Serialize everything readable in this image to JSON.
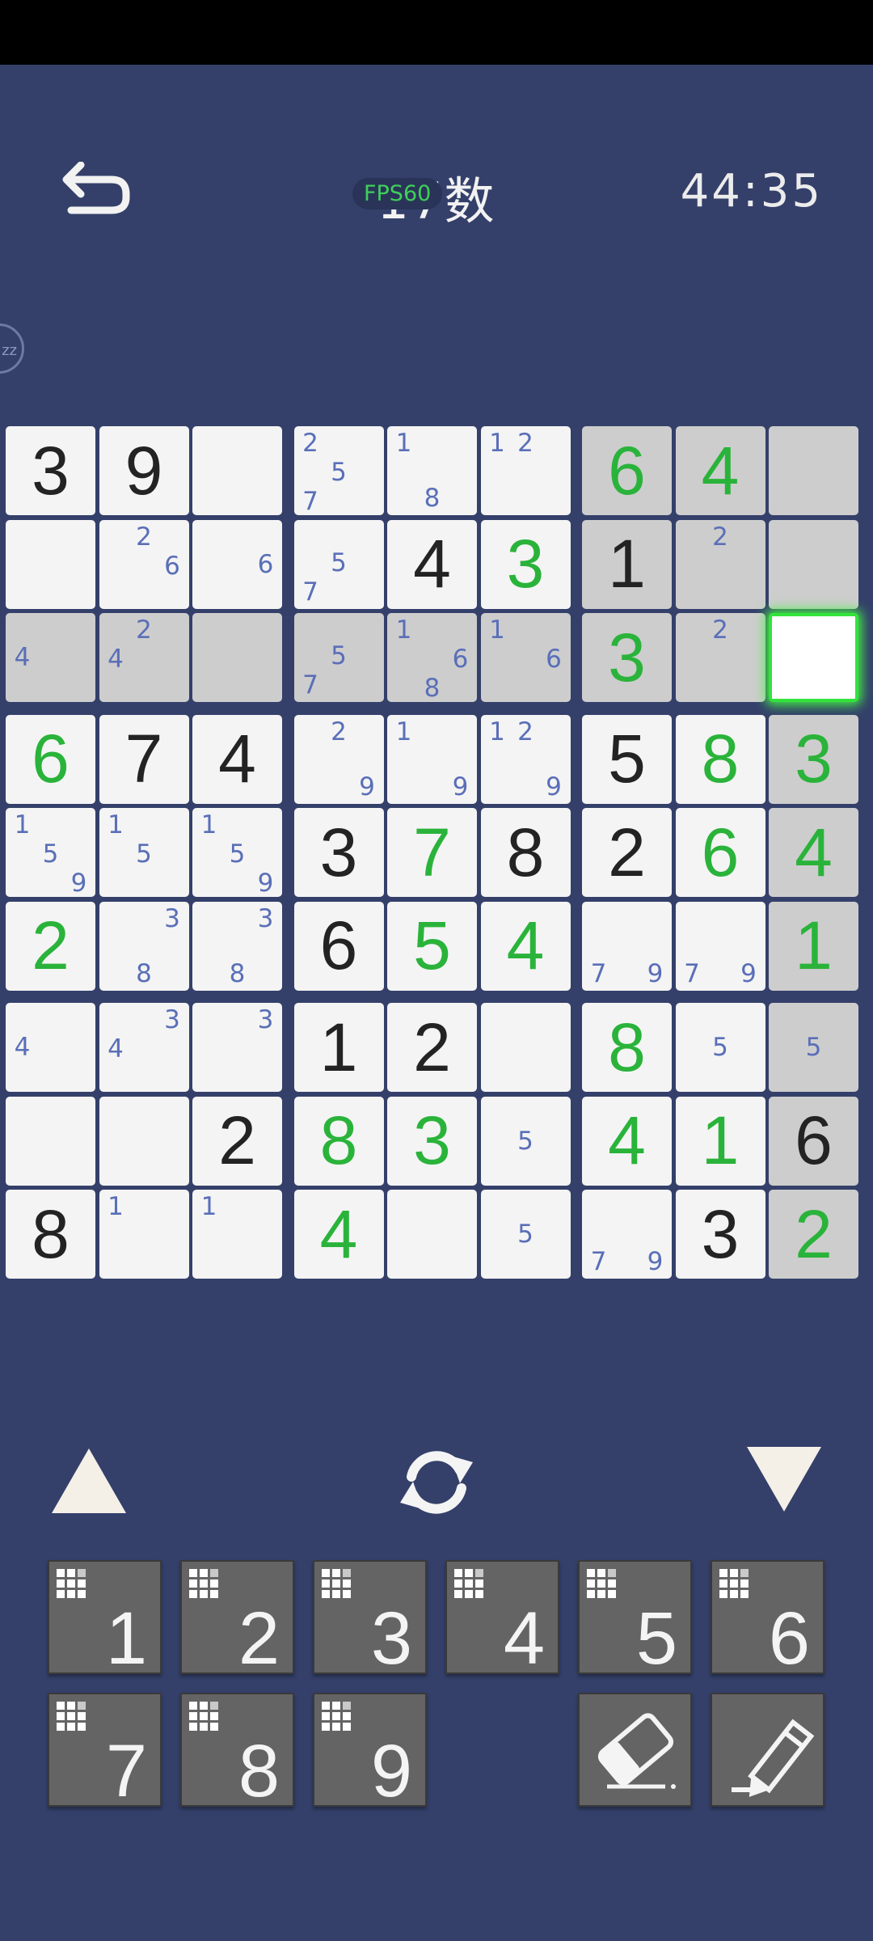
{
  "header": {
    "title": "17数",
    "fps": "FPS60",
    "timer": "44:35",
    "side_badge": "zz"
  },
  "board": {
    "selected_cell": [
      2,
      8
    ],
    "cells": [
      [
        {
          "v": "3",
          "t": "given"
        },
        {
          "v": "9",
          "t": "given"
        },
        {
          "n": []
        },
        {
          "n": [
            "2",
            "",
            "",
            "",
            "5",
            "",
            "7",
            "",
            ""
          ]
        },
        {
          "n": [
            "1",
            "",
            "",
            "",
            "",
            "",
            "",
            "8",
            ""
          ]
        },
        {
          "n": [
            "1",
            "2",
            "",
            "",
            "",
            "",
            "",
            "",
            ""
          ]
        },
        {
          "v": "6",
          "t": "user",
          "s": 1
        },
        {
          "v": "4",
          "t": "user",
          "s": 1
        },
        {
          "n": [],
          "s": 1
        }
      ],
      [
        {
          "n": []
        },
        {
          "n": [
            "",
            "2",
            "",
            "",
            "",
            "6",
            "",
            "",
            ""
          ]
        },
        {
          "n": [
            "",
            "",
            "",
            "",
            "",
            "6",
            "",
            "",
            ""
          ]
        },
        {
          "n": [
            "",
            "",
            "",
            "",
            "5",
            "",
            "7",
            "",
            ""
          ]
        },
        {
          "v": "4",
          "t": "given"
        },
        {
          "v": "3",
          "t": "user"
        },
        {
          "v": "1",
          "t": "given",
          "s": 1
        },
        {
          "n": [
            "",
            "2",
            "",
            "",
            "",
            "",
            "",
            "",
            ""
          ],
          "s": 1
        },
        {
          "n": [],
          "s": 1
        }
      ],
      [
        {
          "n": [
            "",
            "",
            "",
            "4",
            "",
            "",
            "",
            "",
            ""
          ],
          "s": 1
        },
        {
          "n": [
            "",
            "2",
            "",
            "4",
            "",
            "",
            "",
            "",
            ""
          ],
          "s": 1
        },
        {
          "n": [],
          "s": 1
        },
        {
          "n": [
            "",
            "",
            "",
            "",
            "5",
            "",
            "7",
            "",
            ""
          ],
          "s": 1
        },
        {
          "n": [
            "1",
            "",
            "",
            "",
            "",
            "6",
            "",
            "8",
            ""
          ],
          "s": 1
        },
        {
          "n": [
            "1",
            "",
            "",
            "",
            "",
            "6",
            "",
            "",
            ""
          ],
          "s": 1
        },
        {
          "v": "3",
          "t": "user",
          "s": 1
        },
        {
          "n": [
            "",
            "2",
            "",
            "",
            "",
            "",
            "",
            "",
            ""
          ],
          "s": 1
        },
        {
          "n": [],
          "sel": 1
        }
      ],
      [
        {
          "v": "6",
          "t": "user"
        },
        {
          "v": "7",
          "t": "given"
        },
        {
          "v": "4",
          "t": "given"
        },
        {
          "n": [
            "",
            "2",
            "",
            "",
            "",
            "",
            "",
            "",
            "9"
          ]
        },
        {
          "n": [
            "1",
            "",
            "",
            "",
            "",
            "",
            "",
            "",
            "9"
          ]
        },
        {
          "n": [
            "1",
            "2",
            "",
            "",
            "",
            "",
            "",
            "",
            "9"
          ]
        },
        {
          "v": "5",
          "t": "given"
        },
        {
          "v": "8",
          "t": "user"
        },
        {
          "v": "3",
          "t": "user",
          "s": 1
        }
      ],
      [
        {
          "n": [
            "1",
            "",
            "",
            "",
            "5",
            "",
            "",
            "",
            "9"
          ]
        },
        {
          "n": [
            "1",
            "",
            "",
            "",
            "5",
            "",
            "",
            "",
            ""
          ]
        },
        {
          "n": [
            "1",
            "",
            "",
            "",
            "5",
            "",
            "",
            "",
            "9"
          ]
        },
        {
          "v": "3",
          "t": "given"
        },
        {
          "v": "7",
          "t": "user"
        },
        {
          "v": "8",
          "t": "given"
        },
        {
          "v": "2",
          "t": "given"
        },
        {
          "v": "6",
          "t": "user"
        },
        {
          "v": "4",
          "t": "user",
          "s": 1
        }
      ],
      [
        {
          "v": "2",
          "t": "user"
        },
        {
          "n": [
            "",
            "",
            "3",
            "",
            "",
            "",
            "",
            "8",
            ""
          ]
        },
        {
          "n": [
            "",
            "",
            "3",
            "",
            "",
            "",
            "",
            "8",
            ""
          ]
        },
        {
          "v": "6",
          "t": "given"
        },
        {
          "v": "5",
          "t": "user"
        },
        {
          "v": "4",
          "t": "user"
        },
        {
          "n": [
            "",
            "",
            "",
            "",
            "",
            "",
            "7",
            "",
            "9"
          ]
        },
        {
          "n": [
            "",
            "",
            "",
            "",
            "",
            "",
            "7",
            "",
            "9"
          ]
        },
        {
          "v": "1",
          "t": "user",
          "s": 1
        }
      ],
      [
        {
          "n": [
            "",
            "",
            "",
            "4",
            "",
            "",
            "",
            "",
            ""
          ]
        },
        {
          "n": [
            "",
            "",
            "3",
            "4",
            "",
            "",
            "",
            "",
            ""
          ]
        },
        {
          "n": [
            "",
            "",
            "3",
            "",
            "",
            "",
            "",
            "",
            ""
          ]
        },
        {
          "v": "1",
          "t": "given"
        },
        {
          "v": "2",
          "t": "given"
        },
        {
          "n": []
        },
        {
          "v": "8",
          "t": "user"
        },
        {
          "n": [
            "",
            "",
            "",
            "",
            "5",
            "",
            "",
            "",
            ""
          ]
        },
        {
          "n": [
            "",
            "",
            "",
            "",
            "5",
            "",
            "",
            "",
            ""
          ],
          "s": 1
        }
      ],
      [
        {
          "n": []
        },
        {
          "n": []
        },
        {
          "v": "2",
          "t": "given"
        },
        {
          "v": "8",
          "t": "user"
        },
        {
          "v": "3",
          "t": "user"
        },
        {
          "n": [
            "",
            "",
            "",
            "",
            "5",
            "",
            "",
            "",
            ""
          ]
        },
        {
          "v": "4",
          "t": "user"
        },
        {
          "v": "1",
          "t": "user"
        },
        {
          "v": "6",
          "t": "given",
          "s": 1
        }
      ],
      [
        {
          "v": "8",
          "t": "given"
        },
        {
          "n": [
            "1",
            "",
            "",
            "",
            "",
            "",
            "",
            "",
            ""
          ]
        },
        {
          "n": [
            "1",
            "",
            "",
            "",
            "",
            "",
            "",
            "",
            ""
          ]
        },
        {
          "v": "4",
          "t": "user"
        },
        {
          "n": []
        },
        {
          "n": [
            "",
            "",
            "",
            "",
            "5",
            "",
            "",
            "",
            ""
          ]
        },
        {
          "n": [
            "",
            "",
            "",
            "",
            "",
            "",
            "7",
            "",
            "9"
          ]
        },
        {
          "v": "3",
          "t": "given"
        },
        {
          "v": "2",
          "t": "user",
          "s": 1
        }
      ]
    ]
  },
  "controls": {
    "up": "triangle-up-icon",
    "refresh": "refresh-icon",
    "down": "triangle-down-icon"
  },
  "keypad": [
    {
      "label": "1"
    },
    {
      "label": "2"
    },
    {
      "label": "3"
    },
    {
      "label": "4"
    },
    {
      "label": "5"
    },
    {
      "label": "6"
    },
    {
      "label": "7"
    },
    {
      "label": "8"
    },
    {
      "label": "9"
    }
  ],
  "colors": {
    "background": "#34406a",
    "given": "#232323",
    "user": "#2ab33a",
    "notes": "#5a6fb8",
    "highlight": "#33e33c"
  }
}
